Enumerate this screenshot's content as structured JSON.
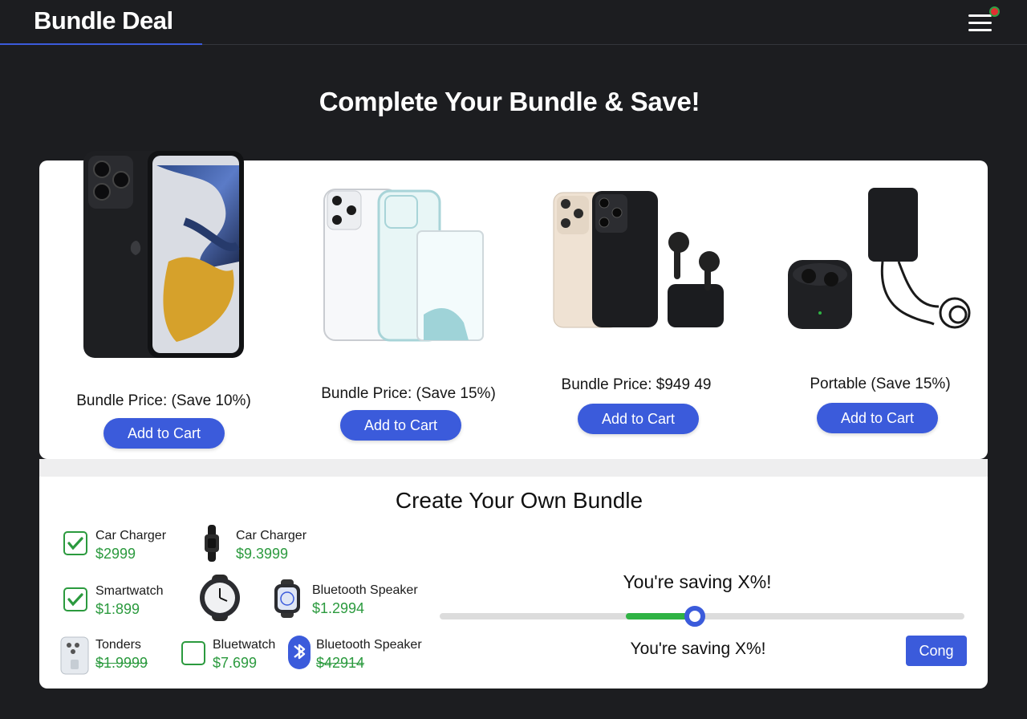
{
  "header": {
    "title": "Bundle Deal"
  },
  "headline": "Complete Your Bundle & Save!",
  "offers": [
    {
      "label": "Bundle Price: (Save 10%)",
      "button": "Add to Cart"
    },
    {
      "label": "Bundle Price: (Save 15%)",
      "button": "Add to Cart"
    },
    {
      "label": "Bundle Price: $949 49",
      "button": "Add to Cart"
    },
    {
      "label": "Portable (Save 15%)",
      "button": "Add to Cart"
    }
  ],
  "builder": {
    "title": "Create Your Own Bundle",
    "items": [
      {
        "name": "Car Charger",
        "price": "$2999",
        "checked": true
      },
      {
        "name": "Car Charger",
        "price": "$9.3999"
      },
      {
        "name": "Smartwatch",
        "price": "$1:899",
        "checked": true
      },
      {
        "name": "Bluetooth Speaker",
        "price": "$1.2994"
      },
      {
        "name": "Tonders",
        "price": "$1.9999"
      },
      {
        "name": "Bluetwatch",
        "price": "$7.699",
        "checked": false
      },
      {
        "name": "Bluetooth Speaker",
        "price": "$42914"
      }
    ],
    "saving_top": "You're saving X%!",
    "saving_bottom": "You're saving X%!",
    "slider_fraction": 0.49,
    "confirm_label": "Cong"
  },
  "colors": {
    "accent": "#3b5bdb",
    "success": "#2b9a3e",
    "background": "#1c1d20"
  }
}
